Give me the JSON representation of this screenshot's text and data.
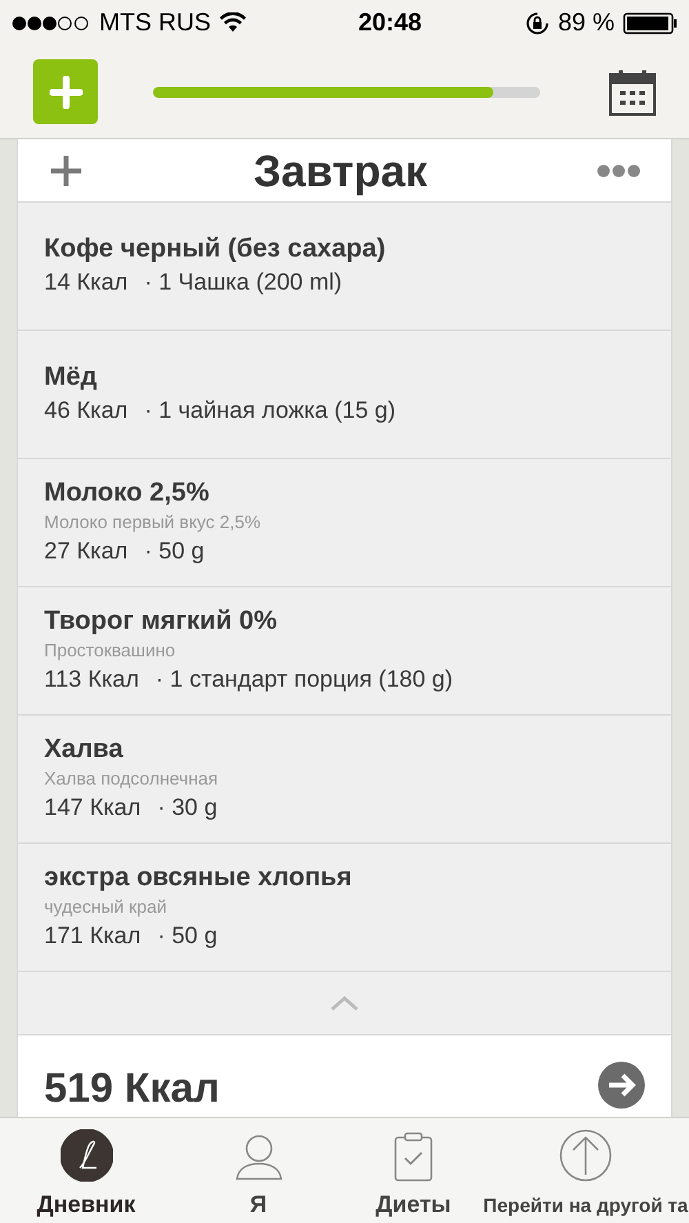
{
  "status_bar": {
    "carrier": "MTS RUS",
    "time": "20:48",
    "battery": "89 %"
  },
  "header": {
    "progress": {
      "level": 0.88
    }
  },
  "meal": {
    "title": "Завтрак",
    "items": [
      {
        "name": "Кофе черный (без сахара)",
        "kcal": "14 Ккал",
        "portion": "· 1 Чашка (200 ml)"
      },
      {
        "name": "Мёд",
        "kcal": "46 Ккал",
        "portion": "· 1 чайная ложка (15 g)"
      },
      {
        "name": "Молоко 2,5%",
        "subtitle": "Молоко первый вкус 2,5%",
        "kcal": "27 Ккал",
        "portion": "· 50 g"
      },
      {
        "name": "Творог мягкий 0%",
        "subtitle": "Простоквашино",
        "kcal": "113 Ккал",
        "portion": "· 1 стандарт порция (180 g)"
      },
      {
        "name": "Халва",
        "subtitle": "Халва подсолнечная",
        "kcal": "147 Ккал",
        "portion": "· 30 g"
      },
      {
        "name": "экстра овсяные хлопья",
        "subtitle": "чудесный край",
        "kcal": "171 Ккал",
        "portion": "· 50 g"
      }
    ],
    "total": "519 Ккал"
  },
  "tabs": [
    {
      "label": "Дневник",
      "kind": "diary",
      "selected": true
    },
    {
      "label": "Я",
      "kind": "me",
      "selected": false
    },
    {
      "label": "Диеты",
      "kind": "diets",
      "selected": false
    },
    {
      "label": "Перейти на другой та",
      "kind": "upload",
      "selected": false
    }
  ]
}
